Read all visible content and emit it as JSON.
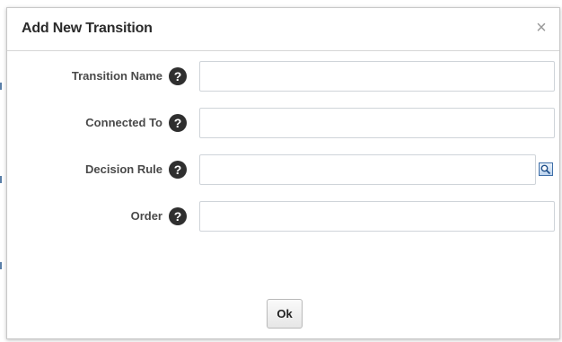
{
  "dialog": {
    "title": "Add New Transition",
    "close_symbol": "×"
  },
  "form": {
    "fields": [
      {
        "label": "Transition Name",
        "value": "",
        "help_icon": "help-question-icon"
      },
      {
        "label": "Connected To",
        "value": "",
        "help_icon": "help-question-icon"
      },
      {
        "label": "Decision Rule",
        "value": "",
        "help_icon": "help-question-icon",
        "lookup_icon": "search-lookup-icon"
      },
      {
        "label": "Order",
        "value": "",
        "help_icon": "help-question-icon"
      }
    ],
    "help_glyph": "?"
  },
  "footer": {
    "ok_label": "Ok"
  },
  "colors": {
    "title_text": "#2b2b2b",
    "label_text": "#4a4a4a",
    "help_icon_bg": "#2f2f2f",
    "input_border": "#cfd4d9",
    "lookup_icon_border": "#3f6fa8"
  }
}
